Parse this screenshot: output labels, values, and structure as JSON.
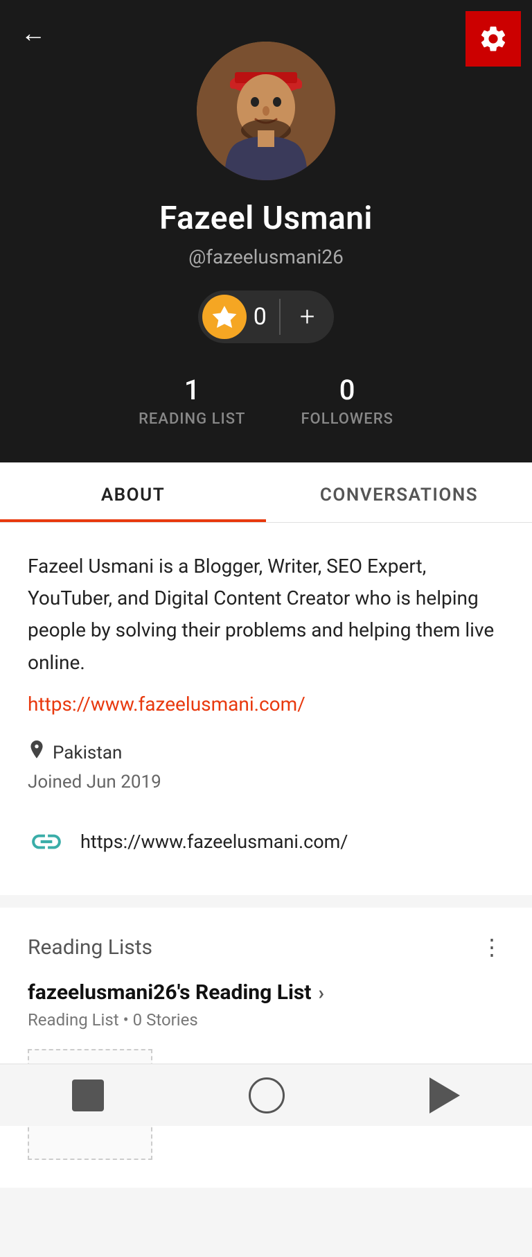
{
  "header": {
    "back_label": "←",
    "settings_label": "⚙"
  },
  "profile": {
    "name": "Fazeel Usmani",
    "handle": "@fazeelusmani26",
    "coins": "0",
    "reading_list_count": "1",
    "reading_list_label": "READING LIST",
    "followers_count": "0",
    "followers_label": "FOLLOWERS"
  },
  "tabs": {
    "about_label": "ABOUT",
    "conversations_label": "CONVERSATIONS"
  },
  "about": {
    "bio": "Fazeel Usmani is a Blogger, Writer, SEO Expert, YouTuber, and Digital Content Creator who is helping people by solving their problems and helping them live online.",
    "website_link": "https://www.fazeelusmani.com/",
    "location": "Pakistan",
    "joined": "Joined Jun 2019",
    "url_display": "https://www.fazeelusmani.com/"
  },
  "reading_lists": {
    "section_title": "Reading Lists",
    "list_name": "fazeelusmani26's Reading List",
    "list_meta": "Reading List • 0 Stories"
  },
  "nav": {
    "square_label": "square",
    "circle_label": "circle",
    "triangle_label": "back"
  }
}
